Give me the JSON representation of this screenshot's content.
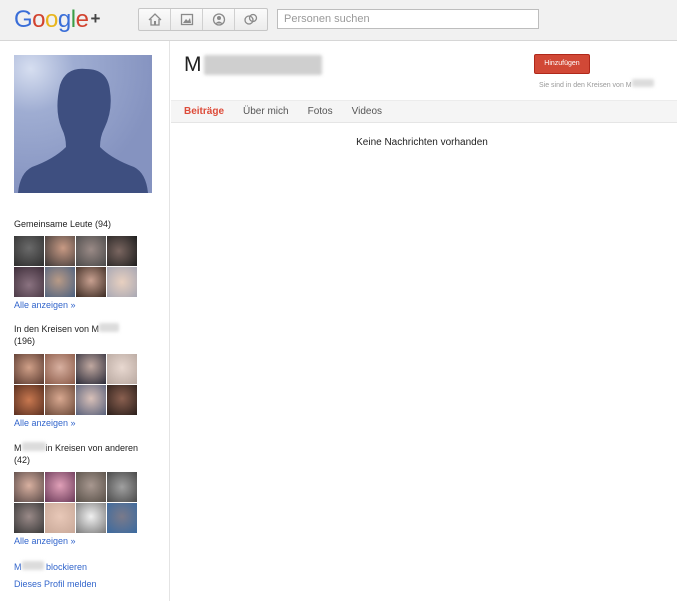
{
  "header": {
    "logo": {
      "G": "G",
      "o1": "o",
      "o2": "o",
      "g": "g",
      "l": "l",
      "e": "e",
      "plus": "+"
    },
    "nav_icons": [
      "home-icon",
      "photos-icon",
      "profile-icon",
      "circles-icon"
    ],
    "search_placeholder": "Personen suchen"
  },
  "profile": {
    "name_initial": "M",
    "add_button": "Hinzufügen",
    "circles_note": "Sie sind in den Kreisen von M"
  },
  "tabs": [
    {
      "label": "Beiträge",
      "active": true
    },
    {
      "label": "Über mich",
      "active": false
    },
    {
      "label": "Fotos",
      "active": false
    },
    {
      "label": "Videos",
      "active": false
    }
  ],
  "main": {
    "empty_message": "Keine Nachrichten vorhanden"
  },
  "sidebar": {
    "common_people": {
      "title": "Gemeinsame Leute (94)",
      "show_all": "Alle anzeigen »"
    },
    "in_circles_of": {
      "title_prefix": "In den Kreisen von M",
      "count": "(196)",
      "show_all": "Alle anzeigen »"
    },
    "in_others_circles": {
      "title_prefix": "M",
      "title_suffix": "in Kreisen von anderen",
      "count": "(42)",
      "show_all": "Alle anzeigen »"
    },
    "block_link_prefix": "M",
    "block_link_suffix": "blockieren",
    "report_link": "Dieses Profil melden"
  },
  "colors": {
    "accent": "#d14836",
    "link": "#3366cc",
    "active_tab": "#dd4b39",
    "avatar_bg": "#8a9ac5"
  }
}
